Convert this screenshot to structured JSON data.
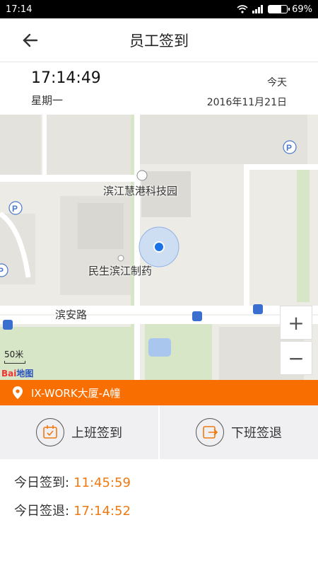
{
  "status_bar": {
    "time": "17:14",
    "battery": "69%",
    "battery_level": 0.69
  },
  "header": {
    "title": "员工签到"
  },
  "time_panel": {
    "clock": "17:14:49",
    "weekday": "星期一",
    "today_label": "今天",
    "date": "2016年11月21日"
  },
  "map": {
    "labels": [
      "滨江慧港科技园",
      "民生滨江制药",
      "滨安路"
    ],
    "zoom_in": "+",
    "zoom_out": "−",
    "scale": "50米",
    "logo_a": "Bai",
    "logo_b": "地图"
  },
  "location": {
    "name": "IX-WORK大厦-A幢"
  },
  "actions": {
    "checkin": "上班签到",
    "checkout": "下班签退"
  },
  "records": {
    "checkin_label": "今日签到:",
    "checkin_time": "11:45:59",
    "checkout_label": "今日签退:",
    "checkout_time": "17:14:52"
  },
  "colors": {
    "accent": "#f96e00",
    "time_value": "#f07a12"
  }
}
